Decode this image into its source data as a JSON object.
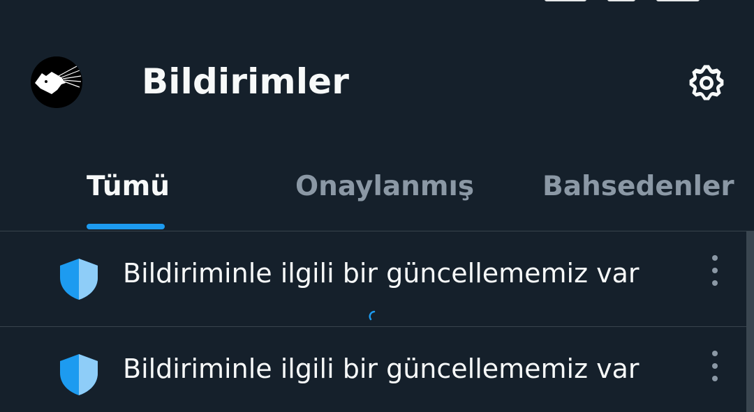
{
  "header": {
    "title": "Bildirimler",
    "avatar_icon": "dog-head-avatar-icon",
    "settings_icon": "gear-icon"
  },
  "tabs": [
    {
      "label": "Tümü",
      "active": true
    },
    {
      "label": "Onaylanmış",
      "active": false
    },
    {
      "label": "Bahsedenler",
      "active": false
    }
  ],
  "notifications": [
    {
      "icon": "shield-icon",
      "text": "Bildiriminle ilgili bir güncellememiz var"
    },
    {
      "icon": "shield-icon",
      "text": "Bildiriminle ilgili bir güncellememiz var"
    }
  ],
  "colors": {
    "background": "#15202b",
    "accent": "#1d9bf0",
    "text_primary": "#f7f9f9",
    "text_secondary": "#8b98a5",
    "divider": "#38444d"
  }
}
